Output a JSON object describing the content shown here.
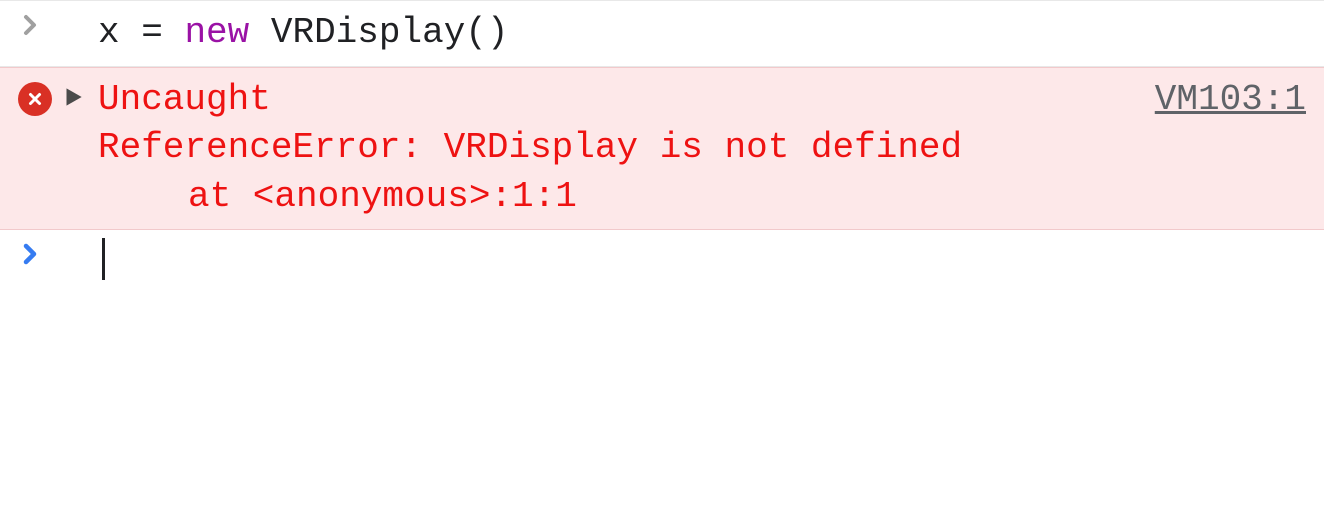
{
  "command": {
    "variable": "x",
    "assign": "=",
    "keyword": "new",
    "identifier": "VRDisplay",
    "open": "(",
    "close": ")"
  },
  "error": {
    "prefix": "Uncaught",
    "message": "ReferenceError: VRDisplay is not defined",
    "stack_at": "at <anonymous>:1:1",
    "source": "VM103:1"
  }
}
